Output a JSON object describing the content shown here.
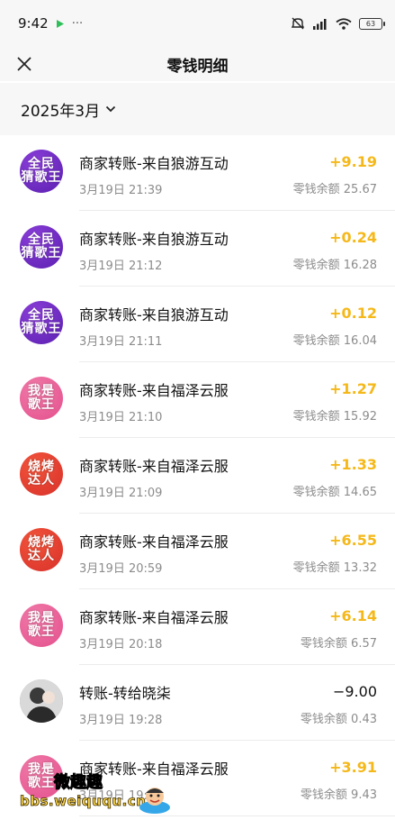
{
  "status_bar": {
    "time": "9:42",
    "battery": "63"
  },
  "header": {
    "title": "零钱明细"
  },
  "filter": {
    "month": "2025年3月"
  },
  "colors": {
    "positive_amount": "#f5b81a",
    "negative_amount": "#111111",
    "avatar_gradients": {
      "qmjgw": [
        "#8b3fd9",
        "#5b1fb0"
      ],
      "wsgw": [
        "#f07aa8",
        "#e4508d"
      ],
      "sklr": [
        "#f2553b",
        "#d8302a"
      ],
      "person": [
        "#c9c9c9",
        "#5a5a5a"
      ]
    }
  },
  "transactions": [
    {
      "avatar_text": "全民\n猜歌王",
      "avatar_style": "qmjgw",
      "title": "商家转账-来自狼游互动",
      "time": "3月19日 21:39",
      "amount": "+9.19",
      "balance": "零钱余额 25.67",
      "negative": false
    },
    {
      "avatar_text": "全民\n猜歌王",
      "avatar_style": "qmjgw",
      "title": "商家转账-来自狼游互动",
      "time": "3月19日 21:12",
      "amount": "+0.24",
      "balance": "零钱余额 16.28",
      "negative": false
    },
    {
      "avatar_text": "全民\n猜歌王",
      "avatar_style": "qmjgw",
      "title": "商家转账-来自狼游互动",
      "time": "3月19日 21:11",
      "amount": "+0.12",
      "balance": "零钱余额 16.04",
      "negative": false
    },
    {
      "avatar_text": "我是\n歌王",
      "avatar_style": "wsgw",
      "title": "商家转账-来自福泽云服",
      "time": "3月19日 21:10",
      "amount": "+1.27",
      "balance": "零钱余额 15.92",
      "negative": false
    },
    {
      "avatar_text": "烧烤\n达人",
      "avatar_style": "sklr",
      "title": "商家转账-来自福泽云服",
      "time": "3月19日 21:09",
      "amount": "+1.33",
      "balance": "零钱余额 14.65",
      "negative": false
    },
    {
      "avatar_text": "烧烤\n达人",
      "avatar_style": "sklr",
      "title": "商家转账-来自福泽云服",
      "time": "3月19日 20:59",
      "amount": "+6.55",
      "balance": "零钱余额 13.32",
      "negative": false
    },
    {
      "avatar_text": "我是\n歌王",
      "avatar_style": "wsgw",
      "title": "商家转账-来自福泽云服",
      "time": "3月19日 20:18",
      "amount": "+6.14",
      "balance": "零钱余额 6.57",
      "negative": false
    },
    {
      "avatar_text": "",
      "avatar_style": "person",
      "title": "转账-转给晓柒",
      "time": "3月19日 19:28",
      "amount": "−9.00",
      "balance": "零钱余额 0.43",
      "negative": true
    },
    {
      "avatar_text": "我是\n歌王",
      "avatar_style": "wsgw",
      "title": "商家转账-来自福泽云服",
      "time": "3月19日 19:1",
      "amount": "+3.91",
      "balance": "零钱余额 9.43",
      "negative": false
    }
  ],
  "watermark": {
    "line1": "微趣趣",
    "line2": "bbs.weiququ.cn"
  }
}
